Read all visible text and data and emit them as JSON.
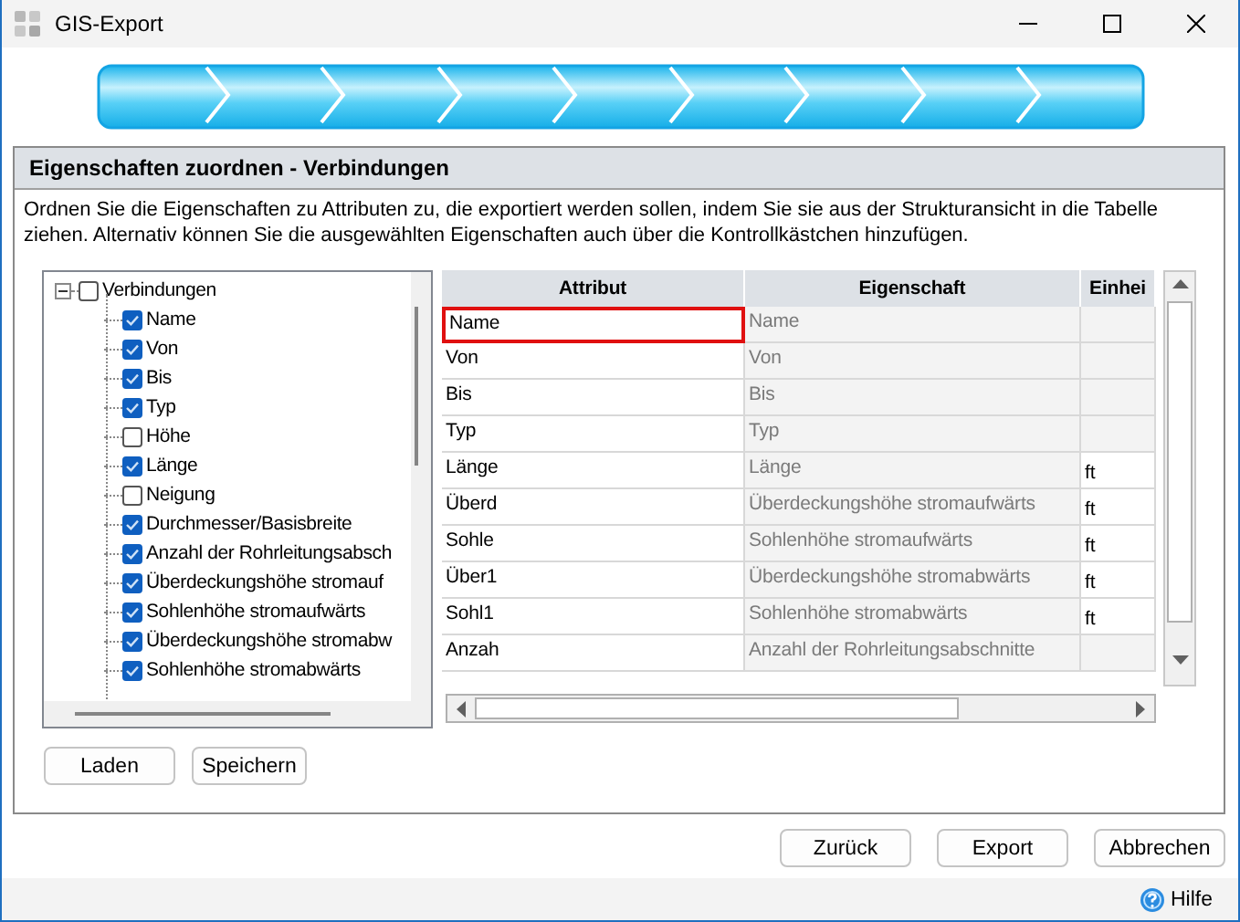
{
  "window": {
    "title": "GIS-Export"
  },
  "section": {
    "title": "Eigenschaften zuordnen - Verbindungen",
    "description": "Ordnen Sie die Eigenschaften zu Attributen zu, die exportiert werden sollen, indem Sie sie aus der Strukturansicht in die Tabelle ziehen. Alternativ können Sie die ausgewählten Eigenschaften auch über die Kontrollkästchen hinzufügen."
  },
  "tree": {
    "label": "Verbindungen",
    "checked": false,
    "expanded": true,
    "children": [
      {
        "label": "Name",
        "checked": true
      },
      {
        "label": "Von",
        "checked": true
      },
      {
        "label": "Bis",
        "checked": true
      },
      {
        "label": "Typ",
        "checked": true
      },
      {
        "label": "Höhe",
        "checked": false
      },
      {
        "label": "Länge",
        "checked": true
      },
      {
        "label": "Neigung",
        "checked": false
      },
      {
        "label": "Durchmesser/Basisbreite",
        "checked": true
      },
      {
        "label": "Anzahl der Rohrleitungsabsch",
        "checked": true
      },
      {
        "label": "Überdeckungshöhe stromauf",
        "checked": true
      },
      {
        "label": "Sohlenhöhe stromaufwärts",
        "checked": true
      },
      {
        "label": "Überdeckungshöhe stromabw",
        "checked": true
      },
      {
        "label": "Sohlenhöhe stromabwärts",
        "checked": true
      }
    ]
  },
  "table": {
    "columns": [
      "Attribut",
      "Eigenschaft",
      "Einhei"
    ],
    "rows": [
      {
        "attribut": "Name",
        "eigenschaft": "Name",
        "selected": true
      },
      {
        "attribut": "Von",
        "eigenschaft": "Von",
        "selected": false
      },
      {
        "attribut": "Bis",
        "eigenschaft": "Bis",
        "selected": false
      },
      {
        "attribut": "Typ",
        "eigenschaft": "Typ",
        "selected": false
      },
      {
        "attribut": "Länge",
        "eigenschaft": "Länge",
        "einheit": "ft",
        "selected": false
      },
      {
        "attribut": "Überd",
        "eigenschaft": "Überdeckungshöhe stromaufwärts",
        "einheit": "ft",
        "selected": false
      },
      {
        "attribut": "Sohle",
        "eigenschaft": "Sohlenhöhe stromaufwärts",
        "einheit": "ft",
        "selected": false
      },
      {
        "attribut": "Über1",
        "eigenschaft": "Überdeckungshöhe stromabwärts",
        "einheit": "ft",
        "selected": false
      },
      {
        "attribut": "Sohl1",
        "eigenschaft": "Sohlenhöhe stromabwärts",
        "einheit": "ft",
        "selected": false
      },
      {
        "attribut": "Anzah",
        "eigenschaft": "Anzahl der Rohrleitungsabschnitte",
        "selected": false
      }
    ]
  },
  "panel_buttons": [
    "Laden",
    "Speichern"
  ],
  "buttons": [
    "Zurück",
    "Export",
    "Abbrechen"
  ],
  "help": {
    "label": "Hilfe"
  }
}
